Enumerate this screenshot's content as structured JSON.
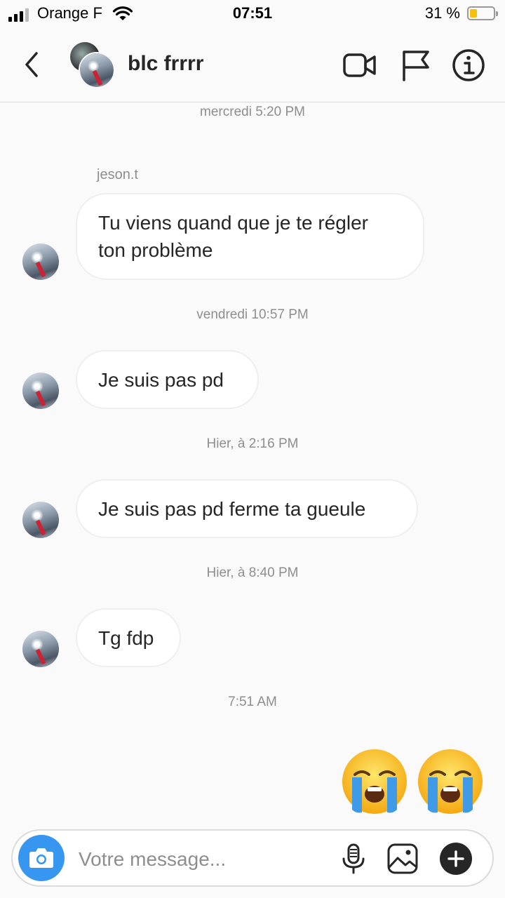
{
  "status_bar": {
    "carrier": "Orange F",
    "time": "07:51",
    "battery_percent": "31 %",
    "battery_level": 0.31
  },
  "header": {
    "thread_name": "blc frrrr",
    "icons": [
      "back-arrow-icon",
      "video-call-icon",
      "flag-icon",
      "info-icon"
    ]
  },
  "messages": [
    {
      "timestamp": "mercredi 5:20 PM",
      "sender": "jeson.t",
      "text_lines": [
        "Tu viens quand que je te régler",
        "ton problème"
      ]
    },
    {
      "timestamp": "vendredi 10:57 PM",
      "text": "Je suis pas pd"
    },
    {
      "timestamp": "Hier, à 2:16 PM",
      "text": "Je suis pas pd ferme ta gueule"
    },
    {
      "timestamp": "Hier, à 8:40 PM",
      "text": "Tg fdp"
    },
    {
      "timestamp": "7:51 AM"
    }
  ],
  "sent_emojis": [
    "loudly-crying-face",
    "loudly-crying-face"
  ],
  "composer": {
    "placeholder": "Votre message...",
    "icons": [
      "camera-icon",
      "microphone-icon",
      "gallery-icon",
      "plus-icon"
    ]
  }
}
